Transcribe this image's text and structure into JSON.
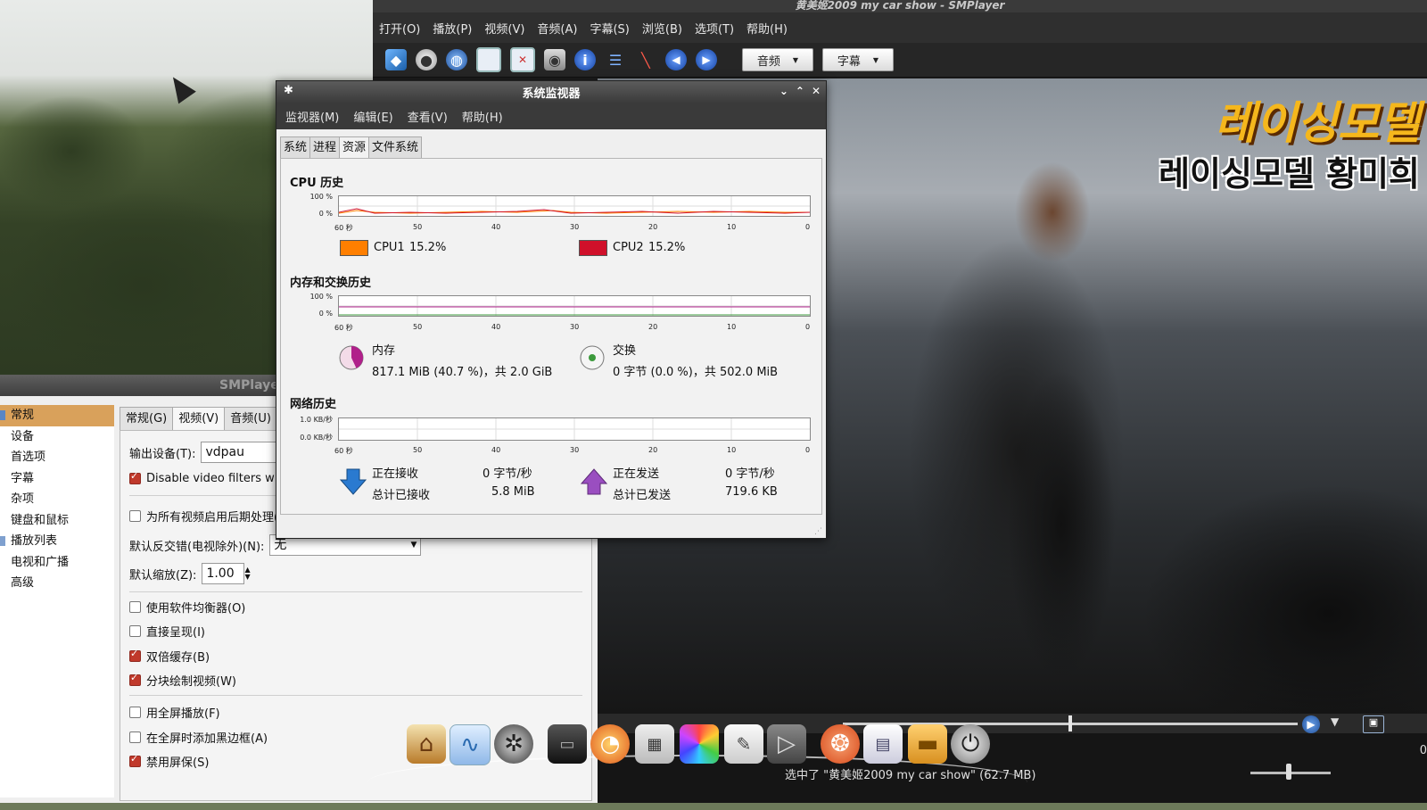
{
  "smplayer": {
    "title": "黄美姬2009 my car show - SMPlayer",
    "menu": [
      "打开(O)",
      "播放(P)",
      "视频(V)",
      "音频(A)",
      "字幕(S)",
      "浏览(B)",
      "选项(T)",
      "帮助(H)"
    ],
    "audio_combo": "音频",
    "subtitle_combo": "字幕",
    "status_text": "选中了 \"黄美姬2009 my car show\" (62.7 MB)",
    "video_overlay_1": "레이싱모델",
    "video_overlay_2": "레이싱모델 황미희",
    "time_partial": "0"
  },
  "prefs": {
    "title": "SMPlayer",
    "sidebar": [
      "常规",
      "设备",
      "首选项",
      "字幕",
      "杂项",
      "键盘和鼠标",
      "播放列表",
      "电视和广播",
      "高级"
    ],
    "tabs": [
      "常规(G)",
      "视频(V)",
      "音频(U)"
    ],
    "output_label": "输出设备(T):",
    "output_value": "vdpau",
    "disable_filters": "Disable video filters w",
    "postprocess": "为所有视频启用后期处理(",
    "deinterlace_label": "默认反交错(电视除外)(N):",
    "deinterlace_value": "无",
    "zoom_label": "默认缩放(Z):",
    "zoom_value": "1.00",
    "options": [
      {
        "label": "使用软件均衡器(O)",
        "checked": false
      },
      {
        "label": "直接呈现(I)",
        "checked": false
      },
      {
        "label": "双倍缓存(B)",
        "checked": true
      },
      {
        "label": "分块绘制视频(W)",
        "checked": true
      }
    ],
    "options2": [
      {
        "label": "用全屏播放(F)",
        "checked": false
      },
      {
        "label": "在全屏时添加黑边框(A)",
        "checked": false
      },
      {
        "label": "禁用屏保(S)",
        "checked": true
      }
    ]
  },
  "sysmon": {
    "title": "系统监视器",
    "menu": [
      "监视器(M)",
      "编辑(E)",
      "查看(V)",
      "帮助(H)"
    ],
    "tabs": [
      "系统",
      "进程",
      "资源",
      "文件系统"
    ],
    "cpu": {
      "title": "CPU 历史",
      "y_top": "100 %",
      "y_bottom": "0 %",
      "cpu1_label": "CPU1",
      "cpu1_value": "15.2%",
      "cpu1_color": "#ff7f00",
      "cpu2_label": "CPU2",
      "cpu2_value": "15.2%",
      "cpu2_color": "#d0102a"
    },
    "mem": {
      "title": "内存和交换历史",
      "y_top": "100 %",
      "y_bottom": "0 %",
      "mem_label": "内存",
      "mem_value": "817.1 MiB (40.7 %)，共 2.0 GiB",
      "swap_label": "交换",
      "swap_value": "0 字节 (0.0 %)，共 502.0 MiB"
    },
    "net": {
      "title": "网络历史",
      "y_top": "1.0 KB/秒",
      "y_bottom": "0.0 KB/秒",
      "recv_label": "正在接收",
      "recv_value": "0 字节/秒",
      "recv_total_label": "总计已接收",
      "recv_total_value": "5.8 MiB",
      "send_label": "正在发送",
      "send_value": "0 字节/秒",
      "send_total_label": "总计已发送",
      "send_total_value": "719.6 KB"
    },
    "x_ticks": [
      "60 秒",
      "50",
      "40",
      "30",
      "20",
      "10",
      "0"
    ]
  },
  "dock": {
    "icons": [
      "home-icon",
      "system-monitor-icon",
      "film-reel-icon",
      "screen-icon",
      "firefox-icon",
      "calculator-icon",
      "color-picker-icon",
      "text-editor-icon",
      "media-player-icon",
      "ubuntu-icon",
      "spreadsheet-icon",
      "folder-icon",
      "power-icon"
    ]
  }
}
